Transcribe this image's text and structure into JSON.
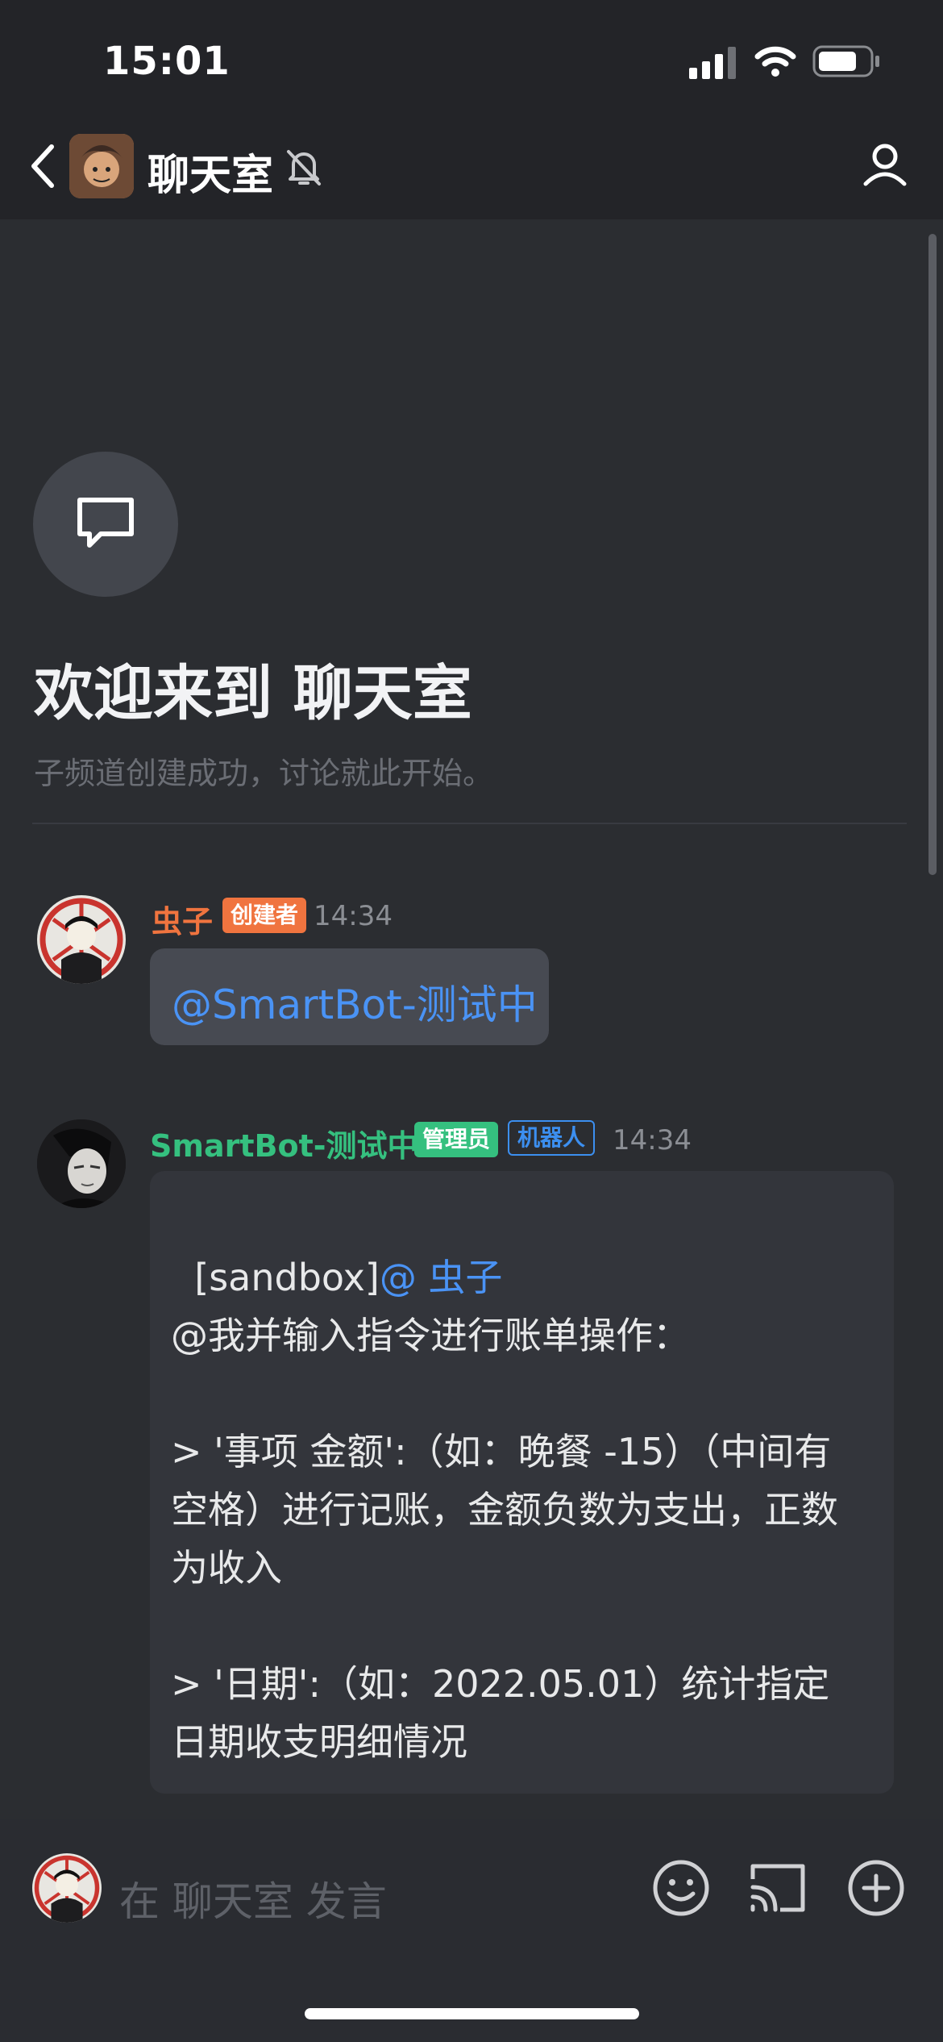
{
  "status_bar": {
    "time": "15:01"
  },
  "header": {
    "title": "聊天室"
  },
  "welcome": {
    "title": "欢迎来到 聊天室",
    "subtitle": "子频道创建成功，讨论就此开始。"
  },
  "messages": [
    {
      "author": "虫子",
      "badges": [
        "创建者"
      ],
      "time": "14:34",
      "mention": "@SmartBot-测试中"
    },
    {
      "author": "SmartBot-测试中",
      "badges": [
        "管理员",
        "机器人"
      ],
      "time": "14:34",
      "prefix": "[sandbox]",
      "mention": "@ 虫子",
      "body": "@我并输入指令进行账单操作：\n\n> '事项 金额':（如：晚餐 -15）（中间有空格）进行记账，金额负数为支出，正数为收入\n\n> '日期':（如：2022.05.01）统计指定日期收支明细情况"
    }
  ],
  "composer": {
    "placeholder": "在 聊天室 发言"
  },
  "colors": {
    "background": "#2b2d31",
    "creator_name": "#f0743f",
    "bot_name": "#35c07f",
    "mention": "#4a93f5"
  }
}
